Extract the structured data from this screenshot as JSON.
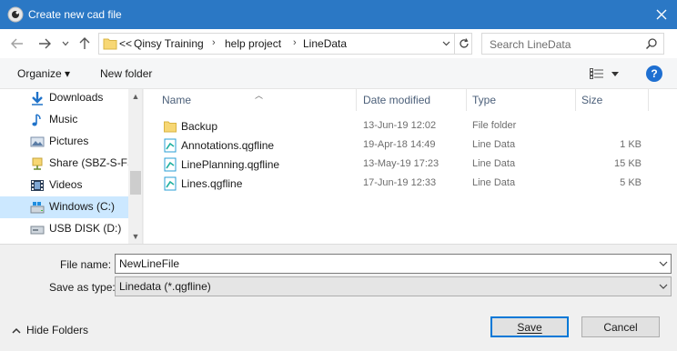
{
  "window": {
    "title": "Create new cad file"
  },
  "address": {
    "overflow": "<<",
    "crumbs": [
      "Qinsy Training",
      "help project",
      "LineData"
    ]
  },
  "search": {
    "placeholder": "Search LineData"
  },
  "toolbar": {
    "organize": "Organize ▾",
    "new_folder": "New folder"
  },
  "nav": {
    "items": [
      {
        "label": "Downloads",
        "icon": "download-icon"
      },
      {
        "label": "Music",
        "icon": "music-icon"
      },
      {
        "label": "Pictures",
        "icon": "pictures-icon"
      },
      {
        "label": "Share (SBZ-S-FS-",
        "icon": "network-drive-icon"
      },
      {
        "label": "Videos",
        "icon": "videos-icon"
      },
      {
        "label": "Windows (C:)",
        "icon": "windows-drive-icon",
        "selected": true
      },
      {
        "label": "USB DISK (D:)",
        "icon": "usb-drive-icon"
      }
    ]
  },
  "columns": {
    "name": "Name",
    "date": "Date modified",
    "type": "Type",
    "size": "Size"
  },
  "files": [
    {
      "name": "Backup",
      "date": "13-Jun-19 12:02",
      "type": "File folder",
      "size": "",
      "icon": "folder-icon"
    },
    {
      "name": "Annotations.qgfline",
      "date": "19-Apr-18 14:49",
      "type": "Line Data",
      "size": "1 KB",
      "icon": "line-file-icon"
    },
    {
      "name": "LinePlanning.qgfline",
      "date": "13-May-19 17:23",
      "type": "Line Data",
      "size": "15 KB",
      "icon": "line-file-icon"
    },
    {
      "name": "Lines.qgfline",
      "date": "17-Jun-19 12:33",
      "type": "Line Data",
      "size": "5 KB",
      "icon": "line-file-icon"
    }
  ],
  "form": {
    "file_name_label": "File name:",
    "file_name_value": "NewLineFile",
    "save_type_label": "Save as type:",
    "save_type_value": "Linedata (*.qgfline)"
  },
  "footer": {
    "hide_folders": "Hide Folders",
    "save": "Save",
    "cancel": "Cancel"
  },
  "colors": {
    "titlebar": "#2b78c5",
    "selection": "#cce8ff",
    "accent": "#0078d7"
  }
}
